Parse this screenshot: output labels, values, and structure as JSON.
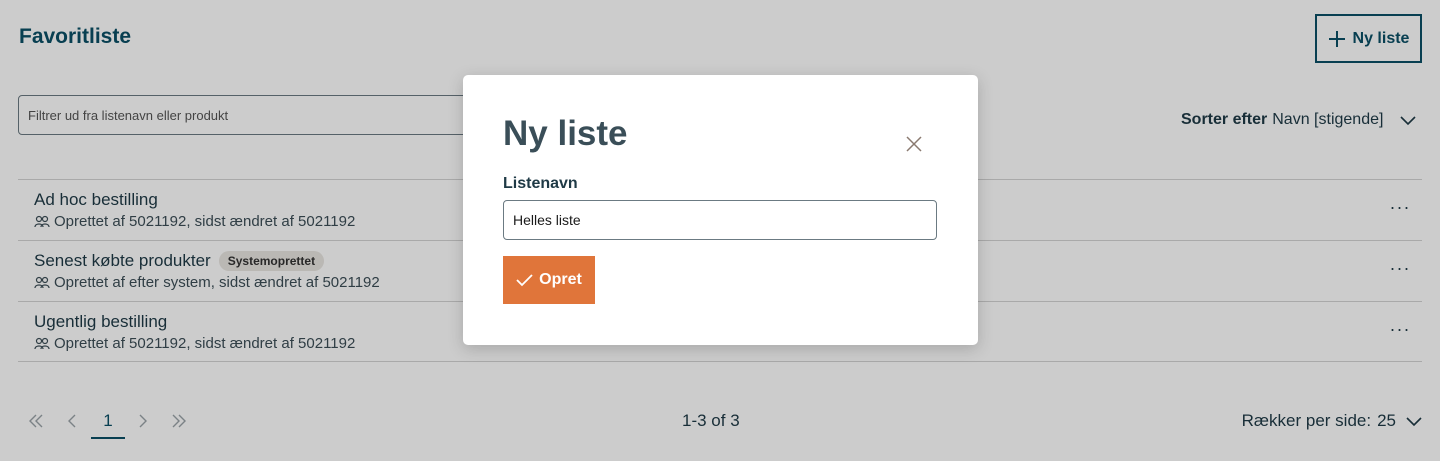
{
  "page": {
    "title": "Favoritliste",
    "new_list_button": "Ny liste",
    "filter_placeholder": "Filtrer ud fra listenavn eller produkt",
    "sort_label": "Sorter efter",
    "sort_value": "Navn [stigende]"
  },
  "lists": [
    {
      "title": "Ad hoc bestilling",
      "badge": "",
      "meta": "Oprettet af 5021192, sidst ændret af 5021192"
    },
    {
      "title": "Senest købte produkter",
      "badge": "Systemoprettet",
      "meta": "Oprettet af efter system, sidst ændret af 5021192"
    },
    {
      "title": "Ugentlig bestilling",
      "badge": "",
      "meta": "Oprettet af 5021192, sidst ændret af 5021192"
    }
  ],
  "pagination": {
    "current_page": "1",
    "range": "1-3 of 3",
    "rows_per_page_label": "Rækker per side:",
    "rows_per_page_value": "25"
  },
  "modal": {
    "title": "Ny liste",
    "field_label": "Listenavn",
    "field_value": "Helles liste",
    "submit_label": "Opret"
  },
  "icons": {
    "new_list": "plus-icon",
    "sort": "chevron-down-icon",
    "list_meta": "users-icon",
    "row_actions": "more-horizontal-icon",
    "first_page": "chevrons-left-icon",
    "prev_page": "chevron-left-icon",
    "next_page": "chevron-right-icon",
    "last_page": "chevrons-right-icon",
    "close": "close-icon",
    "submit": "check-icon"
  },
  "colors": {
    "primary": "#0b4f66",
    "accent": "#e0753a",
    "overlay": "rgba(0,0,0,0.2)"
  }
}
